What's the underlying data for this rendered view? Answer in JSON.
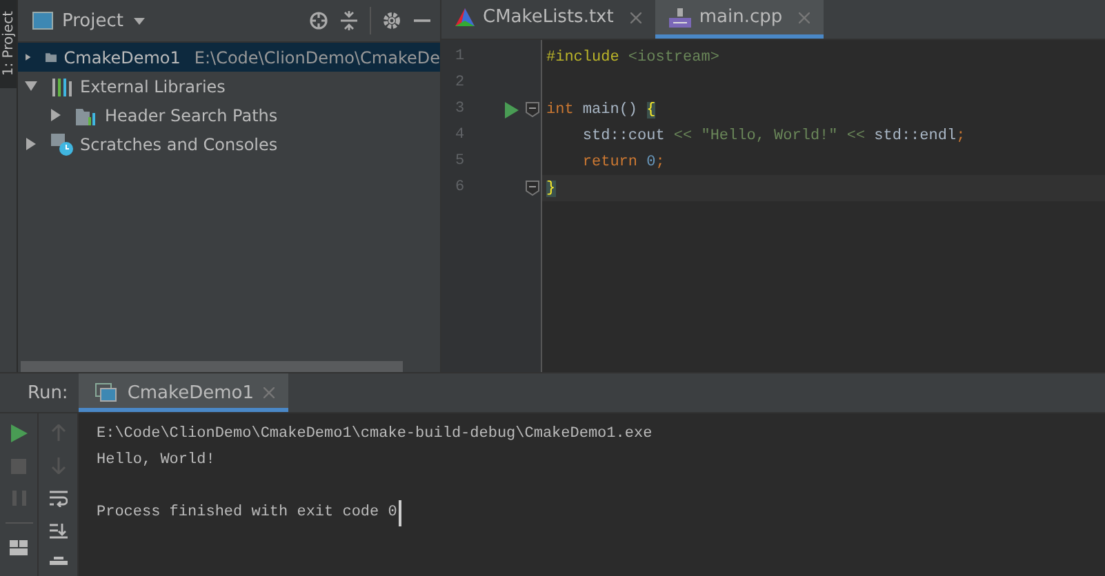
{
  "side_tab": {
    "label": "1: Project",
    "selected": true
  },
  "project_panel": {
    "title": "Project"
  },
  "tree": [
    {
      "label": "CmakeDemo1",
      "kind": "folder",
      "path": "E:\\Code\\ClionDemo\\CmakeDe",
      "expanded": false,
      "selected": true
    },
    {
      "label": "External Libraries",
      "kind": "library",
      "expanded": true,
      "selected": false,
      "children": [
        {
          "label": "Header Search Paths",
          "kind": "header",
          "expanded": false,
          "selected": false
        }
      ]
    },
    {
      "label": "Scratches and Consoles",
      "kind": "scratch",
      "expanded": false,
      "selected": false
    }
  ],
  "editor_tabs": [
    {
      "label": "CMakeLists.txt",
      "kind": "cmake",
      "selected": false
    },
    {
      "label": "main.cpp",
      "kind": "cpp",
      "selected": true
    }
  ],
  "code": [
    {
      "number": "1",
      "tokens": [
        {
          "text": "#include",
          "kind": "directive"
        },
        {
          "text": " <iostream>",
          "kind": "string"
        }
      ]
    },
    {
      "number": "2"
    },
    {
      "number": "3",
      "run": true,
      "fold": true,
      "tokens": [
        {
          "text": "int",
          "kind": "keyword"
        },
        {
          "text": " main() ",
          "kind": "plain"
        },
        {
          "text": "{",
          "kind": "brace"
        }
      ]
    },
    {
      "number": "4",
      "tokens": [
        {
          "text": "    std::cout ",
          "kind": "plain"
        },
        {
          "text": "<<",
          "kind": "op"
        },
        {
          "text": " \"Hello, World!\" ",
          "kind": "literal"
        },
        {
          "text": "<<",
          "kind": "op"
        },
        {
          "text": " std::endl",
          "kind": "plain"
        },
        {
          "text": ";",
          "kind": "keyword"
        }
      ]
    },
    {
      "number": "5",
      "tokens": [
        {
          "text": "    return",
          "kind": "keyword"
        },
        {
          "text": " 0",
          "kind": "number"
        },
        {
          "text": ";",
          "kind": "keyword"
        }
      ]
    },
    {
      "number": "6",
      "fold": true,
      "current": true,
      "tokens": [
        {
          "text": "}",
          "kind": "brace"
        }
      ]
    }
  ],
  "run_panel": {
    "label": "Run:",
    "tab": {
      "label": "CmakeDemo1",
      "selected": true
    }
  },
  "console": [
    {
      "text": "E:\\Code\\ClionDemo\\CmakeDemo1\\cmake-build-debug\\CmakeDemo1.exe",
      "kind": "command"
    },
    {
      "text": "Hello, World!",
      "kind": "output"
    },
    {
      "text": "Process finished with exit code 0",
      "kind": "exit"
    }
  ]
}
